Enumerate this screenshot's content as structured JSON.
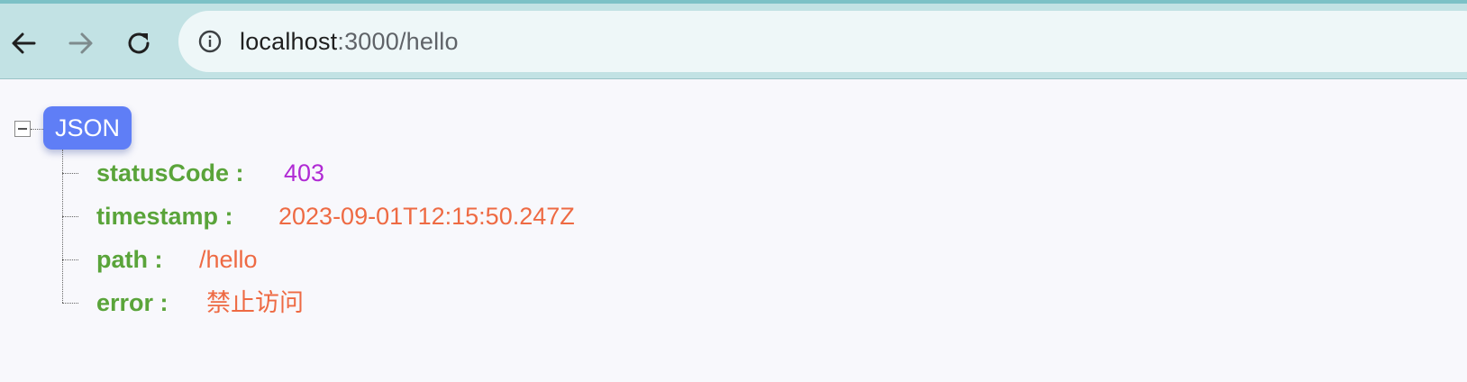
{
  "browser": {
    "url_host": "localhost",
    "url_rest": ":3000/hello",
    "icons": {
      "back": "arrow-left-icon",
      "forward": "arrow-right-icon",
      "reload": "reload-icon",
      "info": "info-icon"
    }
  },
  "viewer": {
    "root_label": "JSON",
    "entries": [
      {
        "key": "statusCode :",
        "value": "403",
        "type": "number"
      },
      {
        "key": "timestamp :",
        "value": "2023-09-01T12:15:50.247Z",
        "type": "string"
      },
      {
        "key": "path :",
        "value": "/hello",
        "type": "string"
      },
      {
        "key": "error :",
        "value": "禁止访问",
        "type": "string"
      }
    ]
  },
  "colors": {
    "toolbar": "#c2e2e4",
    "omnibox": "#eef7f8",
    "badge": "#5f7ef6",
    "key": "#5aa43a",
    "number": "#b02ad4",
    "string": "#ee6a43"
  }
}
